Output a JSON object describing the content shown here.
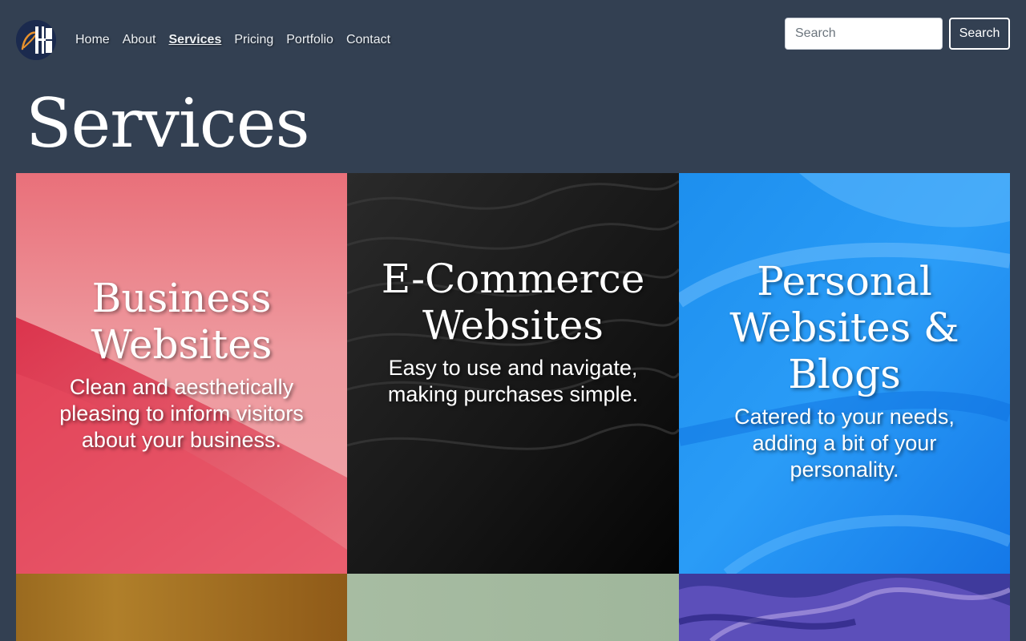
{
  "nav": {
    "links": [
      "Home",
      "About",
      "Services",
      "Pricing",
      "Portfolio",
      "Contact"
    ],
    "active": "Services",
    "search_placeholder": "Search",
    "search_button": "Search"
  },
  "page": {
    "title": "Services"
  },
  "services": [
    {
      "title": "Business Websites",
      "text": "Clean and aesthetically pleasing to inform visitors about your business.",
      "background": "pink-red gradient"
    },
    {
      "title": "E-Commerce Websites",
      "text": "Easy to use and navigate, making purchases simple.",
      "background": "black sand texture"
    },
    {
      "title": "Personal Websites & Blogs",
      "text": "Catered to your needs, adding a bit of your personality.",
      "background": "bright blue waves"
    },
    {
      "title": "",
      "text": "",
      "background": "amber orange"
    },
    {
      "title": "",
      "text": "",
      "background": "sage green"
    },
    {
      "title": "",
      "text": "",
      "background": "purple marble"
    }
  ],
  "colors": {
    "page_background": "#334052",
    "text": "#ffffff",
    "logo_background": "#1b2a4e",
    "logo_accent": "#e8912d"
  },
  "icons": {
    "logo": "brand-logo"
  }
}
